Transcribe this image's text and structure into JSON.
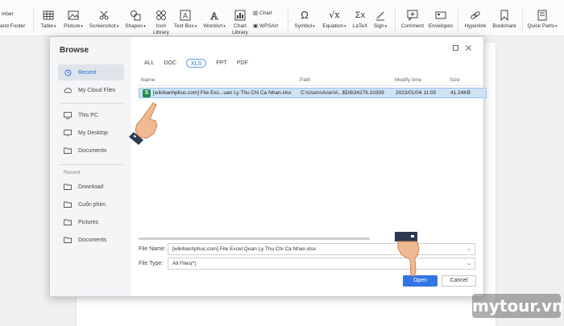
{
  "ribbon": {
    "cut_label1": "mber",
    "cut_label2": "and Footer",
    "table": "Table",
    "picture": "Picture",
    "screenshot": "Screenshot",
    "shapes": "Shapes",
    "icon_library_1": "Icon",
    "icon_library_2": "Library",
    "text_box": "Text Box",
    "wordart": "WordArt",
    "chart_library_1": "Chart",
    "chart_library_2": "Library",
    "chart": "Chart",
    "wpsart": "WPSArt",
    "symbol": "Symbol",
    "equation": "Equation",
    "latex": "LaTeX",
    "sign": "Sign",
    "comment": "Comment",
    "envelopes": "Envelopes",
    "hyperlink": "Hyperlink",
    "bookmark": "Bookmark",
    "quick_parts": "Quick Parts"
  },
  "dialog": {
    "title": "Browse",
    "sidebar": {
      "items": [
        {
          "label": "Recent",
          "icon": "clock-icon"
        },
        {
          "label": "My Cloud Files",
          "icon": "cloud-icon"
        },
        {
          "label": "This PC",
          "icon": "monitor-icon"
        },
        {
          "label": "My Desktop",
          "icon": "desktop-icon"
        },
        {
          "label": "Documents",
          "icon": "folder-icon"
        }
      ],
      "recent_heading": "Recent",
      "recent_items": [
        {
          "label": "Download"
        },
        {
          "label": "Cuốn phim"
        },
        {
          "label": "Pictures"
        },
        {
          "label": "Documents"
        }
      ]
    },
    "filters": [
      "ALL",
      "DOC",
      "XLS",
      "PPT",
      "PDF"
    ],
    "selected_filter": "XLS",
    "columns": {
      "name": "Name",
      "path": "Path",
      "modify_time": "Modify time",
      "size": "Size"
    },
    "files": [
      {
        "icon_letter": "S",
        "name": "[wikihanhphuc.com] File Exc...uan Ly Thu Chi Ca Nhan.xlsx",
        "path": "C:\\Users\\Acer\\A...$DIb34276.10309",
        "modify_time": "2023/01/04 11:05",
        "size": "41.24KB"
      }
    ],
    "file_name_label": "File Name:",
    "file_name_value": "[wikihanhphuc.com] File Excel Quan Ly Thu Chi Ca Nhan.xlsx",
    "file_type_label": "File Type:",
    "file_type_value": "All Files(*)",
    "open_label": "Open",
    "cancel_label": "Cancel"
  },
  "watermark": "mytour.vn",
  "colors": {
    "accent": "#3275e4",
    "selection": "#cfe3f7",
    "xls_green": "#1e8e4f"
  }
}
